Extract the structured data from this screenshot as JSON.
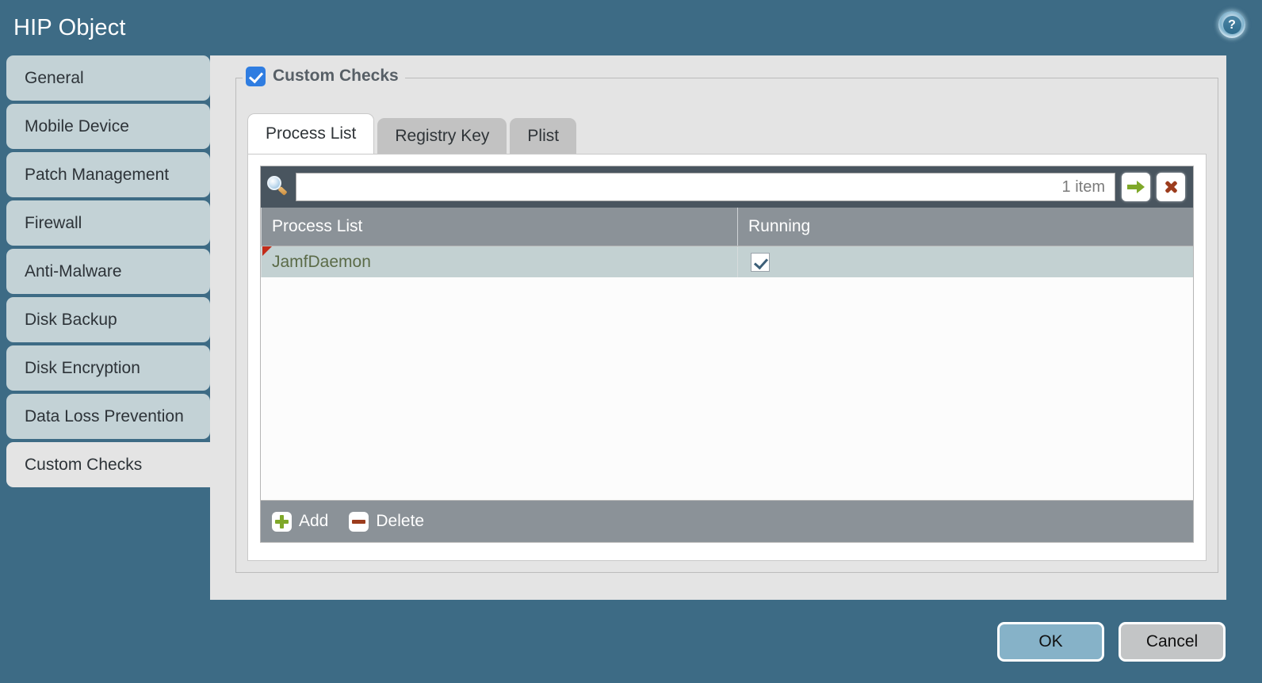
{
  "dialog": {
    "title": "HIP Object",
    "help_icon": "help-circle-icon",
    "accent_color": "#3d6b85",
    "panel_color": "#e4e4e4"
  },
  "sidebar": {
    "items": [
      {
        "label": "General",
        "selected": false
      },
      {
        "label": "Mobile Device",
        "selected": false
      },
      {
        "label": "Patch Management",
        "selected": false
      },
      {
        "label": "Firewall",
        "selected": false
      },
      {
        "label": "Anti-Malware",
        "selected": false
      },
      {
        "label": "Disk Backup",
        "selected": false
      },
      {
        "label": "Disk Encryption",
        "selected": false
      },
      {
        "label": "Data Loss Prevention",
        "selected": false
      },
      {
        "label": "Custom Checks",
        "selected": true
      }
    ]
  },
  "main": {
    "group": {
      "legend": "Custom Checks",
      "checked": true
    },
    "tabs": [
      {
        "label": "Process List",
        "active": true
      },
      {
        "label": "Registry Key",
        "active": false
      },
      {
        "label": "Plist",
        "active": false
      }
    ],
    "grid": {
      "filter": {
        "search_icon": "magnifier-icon",
        "value": "",
        "placeholder": "",
        "item_count": "1 item",
        "apply_icon": "green-arrow-icon",
        "clear_icon": "red-x-icon"
      },
      "columns": [
        "Process List",
        "Running"
      ],
      "rows": [
        {
          "name": "JamfDaemon",
          "running": true,
          "flagged": true
        }
      ],
      "footer": {
        "add_label": "Add",
        "add_icon": "plus-icon",
        "delete_label": "Delete",
        "delete_icon": "minus-icon"
      }
    }
  },
  "footer": {
    "ok_label": "OK",
    "cancel_label": "Cancel"
  }
}
